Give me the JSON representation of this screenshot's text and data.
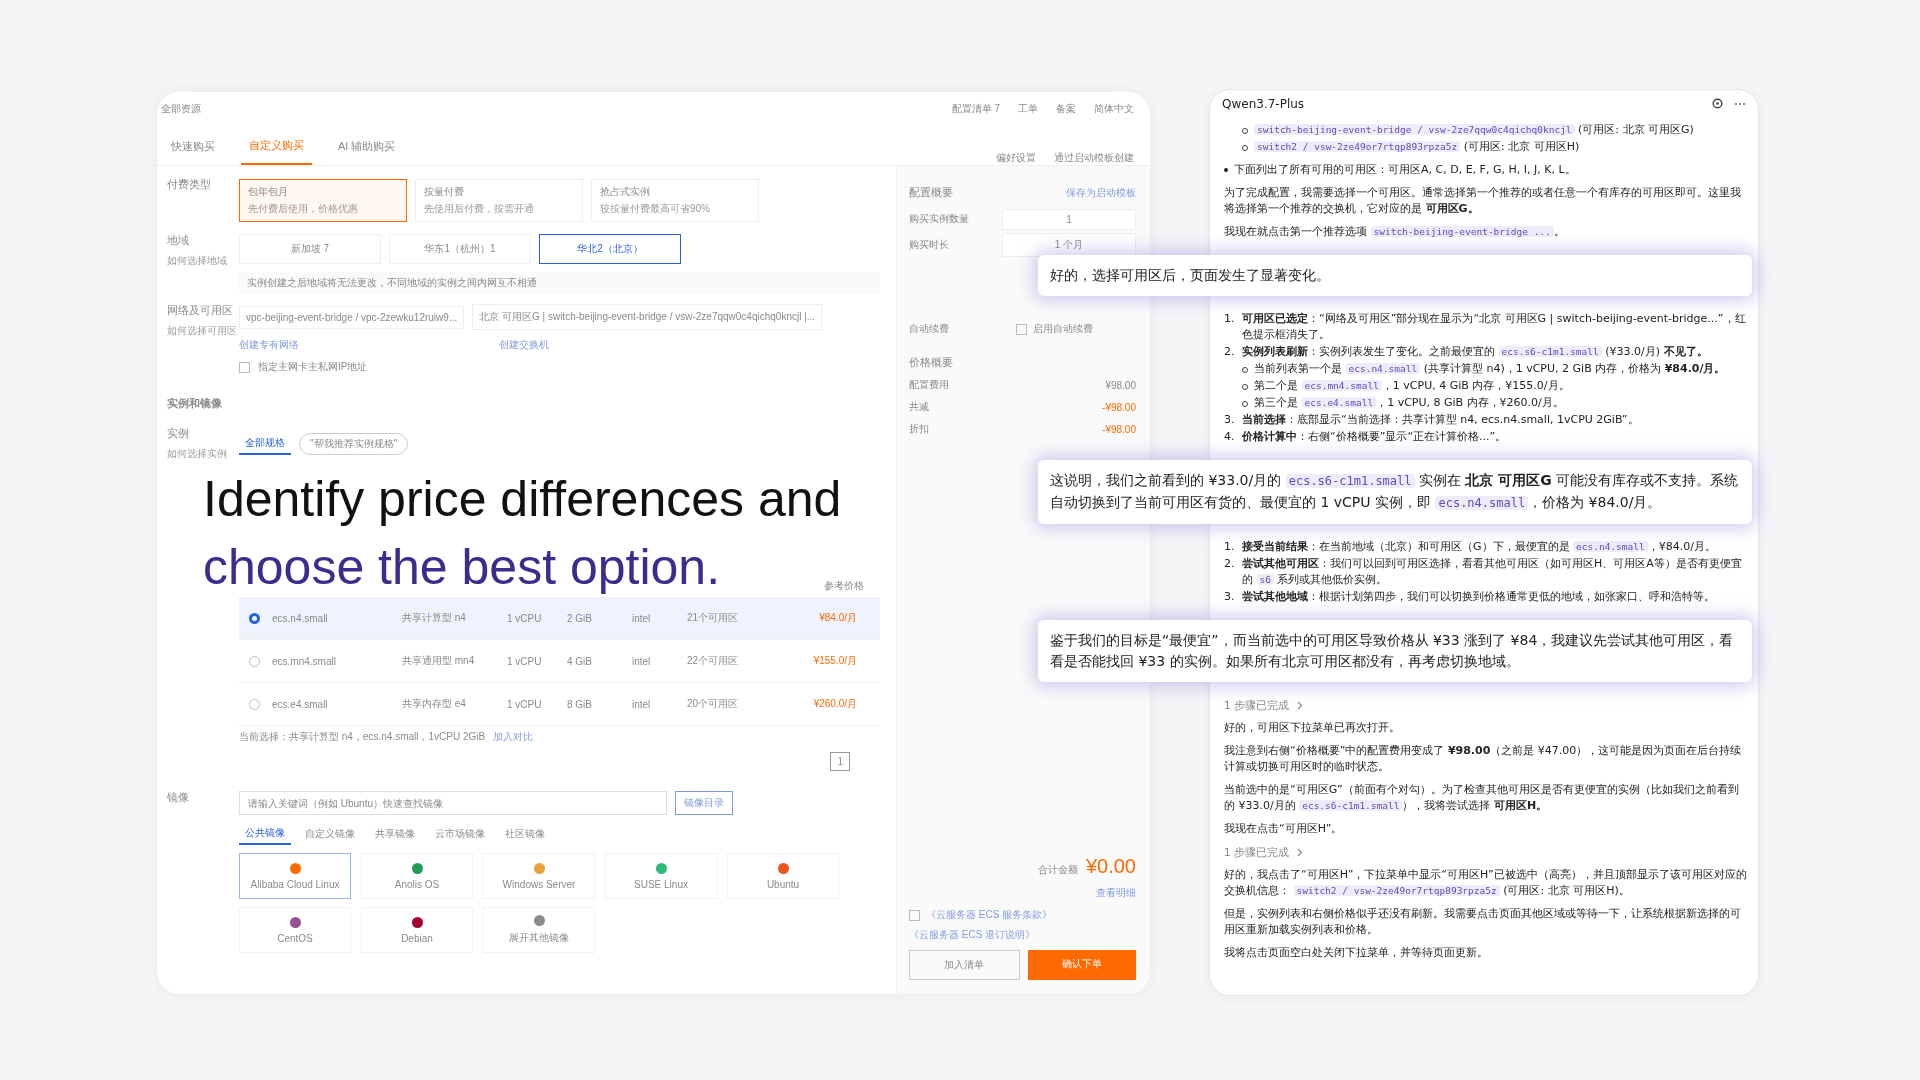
{
  "headline": {
    "line_1": "Identify price differences and",
    "line_2": "choose the best option."
  },
  "console": {
    "top_bar": {
      "menu": "全部资源",
      "links": [
        "配置清单 7",
        "工单",
        "备案",
        "简体中文"
      ]
    },
    "tabs": [
      {
        "label": "快速购买",
        "selected": false
      },
      {
        "label": "自定义购买",
        "selected": true
      },
      {
        "label": "AI 辅助购买",
        "selected": false
      }
    ],
    "tab_links": [
      "偏好设置",
      "通过启动模板创建"
    ],
    "billing": {
      "label": "付费类型",
      "options": [
        {
          "title": "包年包月",
          "hint": "先付费后使用，价格优惠",
          "selected": true
        },
        {
          "title": "按量付费",
          "hint": "先使用后付费，按需开通",
          "selected": false
        },
        {
          "title": "抢占式实例",
          "hint": "较按量付费最高可省90%",
          "selected": false
        }
      ]
    },
    "region": {
      "label": "地域",
      "help": "如何选择地域",
      "options": [
        {
          "label": "新加坡 7",
          "selected": false
        },
        {
          "label": "华东1（杭州）1",
          "selected": false
        },
        {
          "label": "华北2（北京）",
          "selected": true
        }
      ],
      "notice": "实例创建之后地域将无法更改，不同地域的实例之间内网互不相通"
    },
    "network": {
      "label": "网络及可用区",
      "help": "如何选择可用区",
      "vpc": "vpc-beijing-event-bridge / vpc-2zewku12ruiw9...",
      "zone": "北京 可用区G | switch-beijing-event-bridge / vsw-2ze7qqw0c4qichq0kncjl |...",
      "links": [
        "创建专有网络",
        "创建交换机"
      ],
      "private_ip": {
        "label": "指定主网卡主私网IP地址",
        "checked": false
      }
    },
    "instance": {
      "section_title": "实例和镜像",
      "label": "实例",
      "help": "如何选择实例",
      "tabs": [
        {
          "label": "全部规格",
          "selected": true
        }
      ],
      "recommend_button": "\"帮我推荐实例规格\"",
      "price_header": "参考价格",
      "rows": [
        {
          "cells": [
            "ecs.n4.small",
            "共享计算型 n4",
            "1 vCPU",
            "2 GiB",
            "intel",
            "21个可用区",
            "¥84.0/月"
          ],
          "selected": true
        },
        {
          "cells": [
            "ecs.mn4.small",
            "共享通用型 mn4",
            "1 vCPU",
            "4 GiB",
            "intel",
            "22个可用区",
            "¥155.0/月"
          ],
          "selected": false
        },
        {
          "cells": [
            "ecs.e4.small",
            "共享内存型 e4",
            "1 vCPU",
            "8 GiB",
            "intel",
            "20个可用区",
            "¥260.0/月"
          ],
          "selected": false
        }
      ],
      "current_selection": "当前选择：共享计算型 n4，ecs.n4.small，1vCPU 2GiB",
      "compare": "加入对比",
      "page": "1"
    },
    "image": {
      "label": "镜像",
      "placeholder": "请输入关键词（例如 Ubuntu）快速查找镜像",
      "catalog_button": "镜像目录",
      "tabs": [
        {
          "label": "公共镜像",
          "selected": true
        },
        {
          "label": "自定义镜像",
          "selected": false
        },
        {
          "label": "共享镜像",
          "selected": false
        },
        {
          "label": "云市场镜像",
          "selected": false
        },
        {
          "label": "社区镜像",
          "selected": false
        }
      ],
      "cards": [
        {
          "label": "Alibaba Cloud Linux",
          "color": "#ff6a00",
          "selected": true
        },
        {
          "label": "Anolis OS",
          "color": "#1f9d55",
          "selected": false
        },
        {
          "label": "Windows Server",
          "color": "#e8a33d",
          "selected": false
        },
        {
          "label": "SUSE Linux",
          "color": "#30ba78",
          "selected": false
        },
        {
          "label": "Ubuntu",
          "color": "#e95420",
          "selected": false
        },
        {
          "label": "CentOS",
          "color": "#9b4f96",
          "selected": false
        },
        {
          "label": "Debian",
          "color": "#a80030",
          "selected": false
        },
        {
          "label": "展开其他镜像",
          "color": "#8c8c8c",
          "selected": false
        }
      ]
    },
    "summary": {
      "title": "配置概要",
      "save_link": "保存为启动模板",
      "quantity_label": "购买实例数量",
      "quantity": "1",
      "duration_label": "购买时长",
      "duration": "1 个月",
      "auto_renew": {
        "label": "自动续费",
        "option": "启用自动续费",
        "checked": false
      },
      "price_title": "价格概要",
      "prices": [
        {
          "label": "配置费用",
          "value": "¥98.00"
        },
        {
          "label": "共减",
          "value": "-¥98.00"
        },
        {
          "label": "折扣",
          "value": "-¥98.00"
        }
      ],
      "total_label": "合计金额",
      "total": "¥0.00",
      "details_link": "查看明细",
      "terms": {
        "checked": false,
        "links": [
          "《云服务器 ECS 服务条款》",
          "《云服务器 ECS 退订说明》"
        ]
      },
      "buttons": [
        "加入清单",
        "确认下单"
      ]
    }
  },
  "chat": {
    "title": "Qwen3.7-Plus",
    "blocks": [
      {
        "kind": "sublist",
        "items": [
          {
            "segments": [
              {
                "kind": "code",
                "text": "switch-beijing-event-bridge / vsw-2ze7qqw0c4qichq0kncjl"
              },
              {
                "kind": "text",
                "text": " (可用区: 北京 可用区G)"
              }
            ]
          },
          {
            "segments": [
              {
                "kind": "code",
                "text": "switch2 / vsw-2ze49or7rtqp893rpza5z"
              },
              {
                "kind": "text",
                "text": " (可用区: 北京 可用区H)"
              }
            ]
          }
        ]
      },
      {
        "kind": "list",
        "items": [
          {
            "segments": [
              {
                "kind": "text",
                "text": "下面列出了所有可用的可用区：可用区A, C, D, E, F, G, H, I, J, K, L。"
              }
            ]
          }
        ]
      },
      {
        "kind": "paragraph",
        "segments": [
          {
            "kind": "text",
            "text": "为了完成配置，我需要选择一个可用区。通常选择第一个推荐的或者任意一个有库存的可用区即可。这里我将选择第一个推荐的交换机，它对应的是 "
          },
          {
            "kind": "bold",
            "text": "可用区G。"
          }
        ]
      },
      {
        "kind": "paragraph",
        "segments": [
          {
            "kind": "text",
            "text": "我现在就点击第一个推荐选项 "
          },
          {
            "kind": "code",
            "text": "switch-beijing-event-bridge ..."
          },
          {
            "kind": "text",
            "text": "。"
          }
        ]
      },
      {
        "kind": "callout",
        "segments": [
          {
            "kind": "text",
            "text": "好的，选择可用区后，页面发生了显著变化。"
          }
        ]
      },
      {
        "kind": "numbered",
        "items": [
          {
            "number": "1.",
            "segments": [
              {
                "kind": "bold",
                "text": "可用区已选定"
              },
              {
                "kind": "text",
                "text": "：“网络及可用区”部分现在显示为“北京 可用区G | switch-beijing-event-bridge...”，红色提示框消失了。"
              }
            ]
          },
          {
            "number": "2.",
            "segments": [
              {
                "kind": "bold",
                "text": "实例列表刷新"
              },
              {
                "kind": "text",
                "text": "：实例列表发生了变化。之前最便宜的 "
              },
              {
                "kind": "code",
                "text": "ecs.s6-c1m1.small"
              },
              {
                "kind": "text",
                "text": " (¥33.0/月) "
              },
              {
                "kind": "bold",
                "text": "不见了。"
              }
            ],
            "children": [
              {
                "segments": [
                  {
                    "kind": "text",
                    "text": "当前列表第一个是 "
                  },
                  {
                    "kind": "code",
                    "text": "ecs.n4.small"
                  },
                  {
                    "kind": "text",
                    "text": " (共享计算型 n4)，1 vCPU, 2 GiB 内存，价格为 "
                  },
                  {
                    "kind": "bold",
                    "text": "¥84.0/月。"
                  }
                ]
              },
              {
                "segments": [
                  {
                    "kind": "text",
                    "text": "第二个是 "
                  },
                  {
                    "kind": "code",
                    "text": "ecs.mn4.small"
                  },
                  {
                    "kind": "text",
                    "text": "，1 vCPU, 4 GiB 内存，¥155.0/月。"
                  }
                ]
              },
              {
                "segments": [
                  {
                    "kind": "text",
                    "text": "第三个是 "
                  },
                  {
                    "kind": "code",
                    "text": "ecs.e4.small"
                  },
                  {
                    "kind": "text",
                    "text": "，1 vCPU, 8 GiB 内存，¥260.0/月。"
                  }
                ]
              }
            ]
          },
          {
            "number": "3.",
            "segments": [
              {
                "kind": "bold",
                "text": "当前选择"
              },
              {
                "kind": "text",
                "text": "：底部显示“当前选择：共享计算型 n4, ecs.n4.small, 1vCPU 2GiB”。"
              }
            ]
          },
          {
            "number": "4.",
            "segments": [
              {
                "kind": "bold",
                "text": "价格计算中"
              },
              {
                "kind": "text",
                "text": "：右侧“价格概要”显示“正在计算价格...”。"
              }
            ]
          }
        ]
      },
      {
        "kind": "callout",
        "segments": [
          {
            "kind": "text",
            "text": "这说明，我们之前看到的 ¥33.0/月的 "
          },
          {
            "kind": "code",
            "text": "ecs.s6-c1m1.small"
          },
          {
            "kind": "text",
            "text": " 实例在 "
          },
          {
            "kind": "bold",
            "text": "北京 可用区G"
          },
          {
            "kind": "text",
            "text": " 可能没有库存或不支持。系统自动切换到了当前可用区有货的、最便宜的 1 vCPU 实例，即 "
          },
          {
            "kind": "code",
            "text": "ecs.n4.small"
          },
          {
            "kind": "text",
            "text": "，价格为 ¥84.0/月。"
          }
        ]
      },
      {
        "kind": "numbered",
        "items": [
          {
            "number": "1.",
            "segments": [
              {
                "kind": "bold",
                "text": "接受当前结果"
              },
              {
                "kind": "text",
                "text": "：在当前地域（北京）和可用区（G）下，最便宜的是 "
              },
              {
                "kind": "code",
                "text": "ecs.n4.small"
              },
              {
                "kind": "text",
                "text": "，¥84.0/月。"
              }
            ]
          },
          {
            "number": "2.",
            "segments": [
              {
                "kind": "bold",
                "text": "尝试其他可用区"
              },
              {
                "kind": "text",
                "text": "：我们可以回到可用区选择，看看其他可用区（如可用区H、可用区A等）是否有更便宜的 "
              },
              {
                "kind": "code",
                "text": "s6"
              },
              {
                "kind": "text",
                "text": " 系列或其他低价实例。"
              }
            ]
          },
          {
            "number": "3.",
            "segments": [
              {
                "kind": "bold",
                "text": "尝试其他地域"
              },
              {
                "kind": "text",
                "text": "：根据计划第四步，我们可以切换到价格通常更低的地域，如张家口、呼和浩特等。"
              }
            ]
          }
        ]
      },
      {
        "kind": "callout",
        "segments": [
          {
            "kind": "text",
            "text": "鉴于我们的目标是“最便宜”，而当前选中的可用区导致价格从 ¥33 涨到了 ¥84，我建议先尝试其他可用区，看看是否能找回 ¥33 的实例。如果所有北京可用区都没有，再考虑切换地域。"
          }
        ]
      },
      {
        "kind": "step",
        "label": "1 步骤已完成"
      },
      {
        "kind": "paragraph",
        "segments": [
          {
            "kind": "text",
            "text": "好的，可用区下拉菜单已再次打开。"
          }
        ]
      },
      {
        "kind": "paragraph",
        "segments": [
          {
            "kind": "text",
            "text": "我注意到右侧“价格概要”中的配置费用变成了 "
          },
          {
            "kind": "bold",
            "text": "¥98.00"
          },
          {
            "kind": "text",
            "text": "（之前是 ¥47.00），这可能是因为页面在后台持续计算或切换可用区时的临时状态。"
          }
        ]
      },
      {
        "kind": "paragraph",
        "segments": [
          {
            "kind": "text",
            "text": "当前选中的是“可用区G”（前面有个对勾）。为了检查其他可用区是否有更便宜的实例（比如我们之前看到的 ¥33.0/月的 "
          },
          {
            "kind": "code",
            "text": "ecs.s6-c1m1.small"
          },
          {
            "kind": "text",
            "text": "），我将尝试选择 "
          },
          {
            "kind": "bold",
            "text": "可用区H。"
          }
        ]
      },
      {
        "kind": "paragraph",
        "segments": [
          {
            "kind": "text",
            "text": "我现在点击“可用区H”。"
          }
        ]
      },
      {
        "kind": "step",
        "label": "1 步骤已完成"
      },
      {
        "kind": "paragraph",
        "segments": [
          {
            "kind": "text",
            "text": "好的，我点击了“可用区H”，下拉菜单中显示“可用区H”已被选中（高亮），并且顶部显示了该可用区对应的交换机信息： "
          },
          {
            "kind": "code",
            "text": "switch2 / vsw-2ze49or7rtqp893rpza5z"
          },
          {
            "kind": "text",
            "text": " (可用区: 北京 可用区H)。"
          }
        ]
      },
      {
        "kind": "paragraph",
        "segments": [
          {
            "kind": "text",
            "text": "但是，实例列表和右侧价格似乎还没有刷新。我需要点击页面其他区域或等待一下，让系统根据新选择的可用区重新加载实例列表和价格。"
          }
        ]
      },
      {
        "kind": "paragraph",
        "segments": [
          {
            "kind": "text",
            "text": "我将点击页面空白处关闭下拉菜单，并等待页面更新。"
          }
        ]
      }
    ]
  }
}
